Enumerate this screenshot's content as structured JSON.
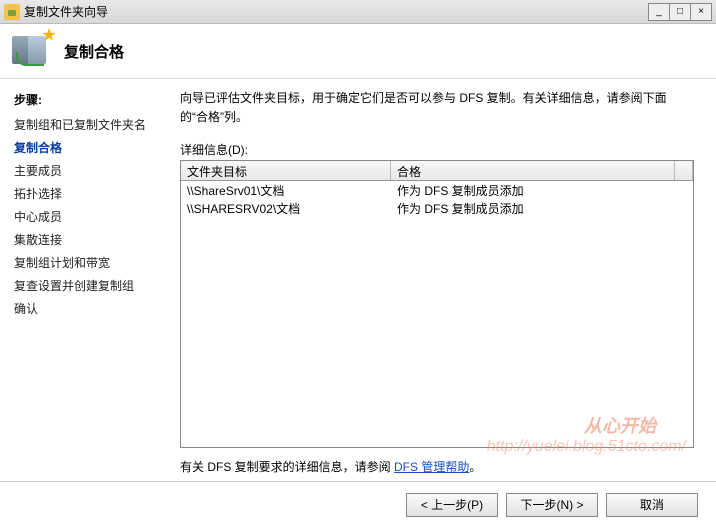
{
  "window": {
    "title": "复制文件夹向导"
  },
  "header": {
    "title": "复制合格"
  },
  "steps": {
    "label": "步骤:",
    "items": [
      "复制组和已复制文件夹名",
      "复制合格",
      "主要成员",
      "拓扑选择",
      "中心成员",
      "集散连接",
      "复制组计划和带宽",
      "复查设置并创建复制组",
      "确认"
    ],
    "current": 1
  },
  "main": {
    "intro": "向导已评估文件夹目标，用于确定它们是否可以参与 DFS 复制。有关详细信息，请参阅下面的“合格”列。",
    "details_label": "详细信息(D):",
    "columns": [
      "文件夹目标",
      "合格"
    ],
    "rows": [
      {
        "target": "\\\\ShareSrv01\\文档",
        "status": "作为 DFS 复制成员添加"
      },
      {
        "target": "\\\\SHARESRV02\\文档",
        "status": "作为 DFS 复制成员添加"
      }
    ],
    "help_prefix": "有关 DFS 复制要求的详细信息，请参阅 ",
    "help_link": "DFS 管理帮助"
  },
  "footer": {
    "back": "< 上一步(P)",
    "next": "下一步(N) >",
    "cancel": "取消"
  },
  "watermark": {
    "line1": "从心开始",
    "line2": "http://yuelei.blog.51cto.com/"
  }
}
